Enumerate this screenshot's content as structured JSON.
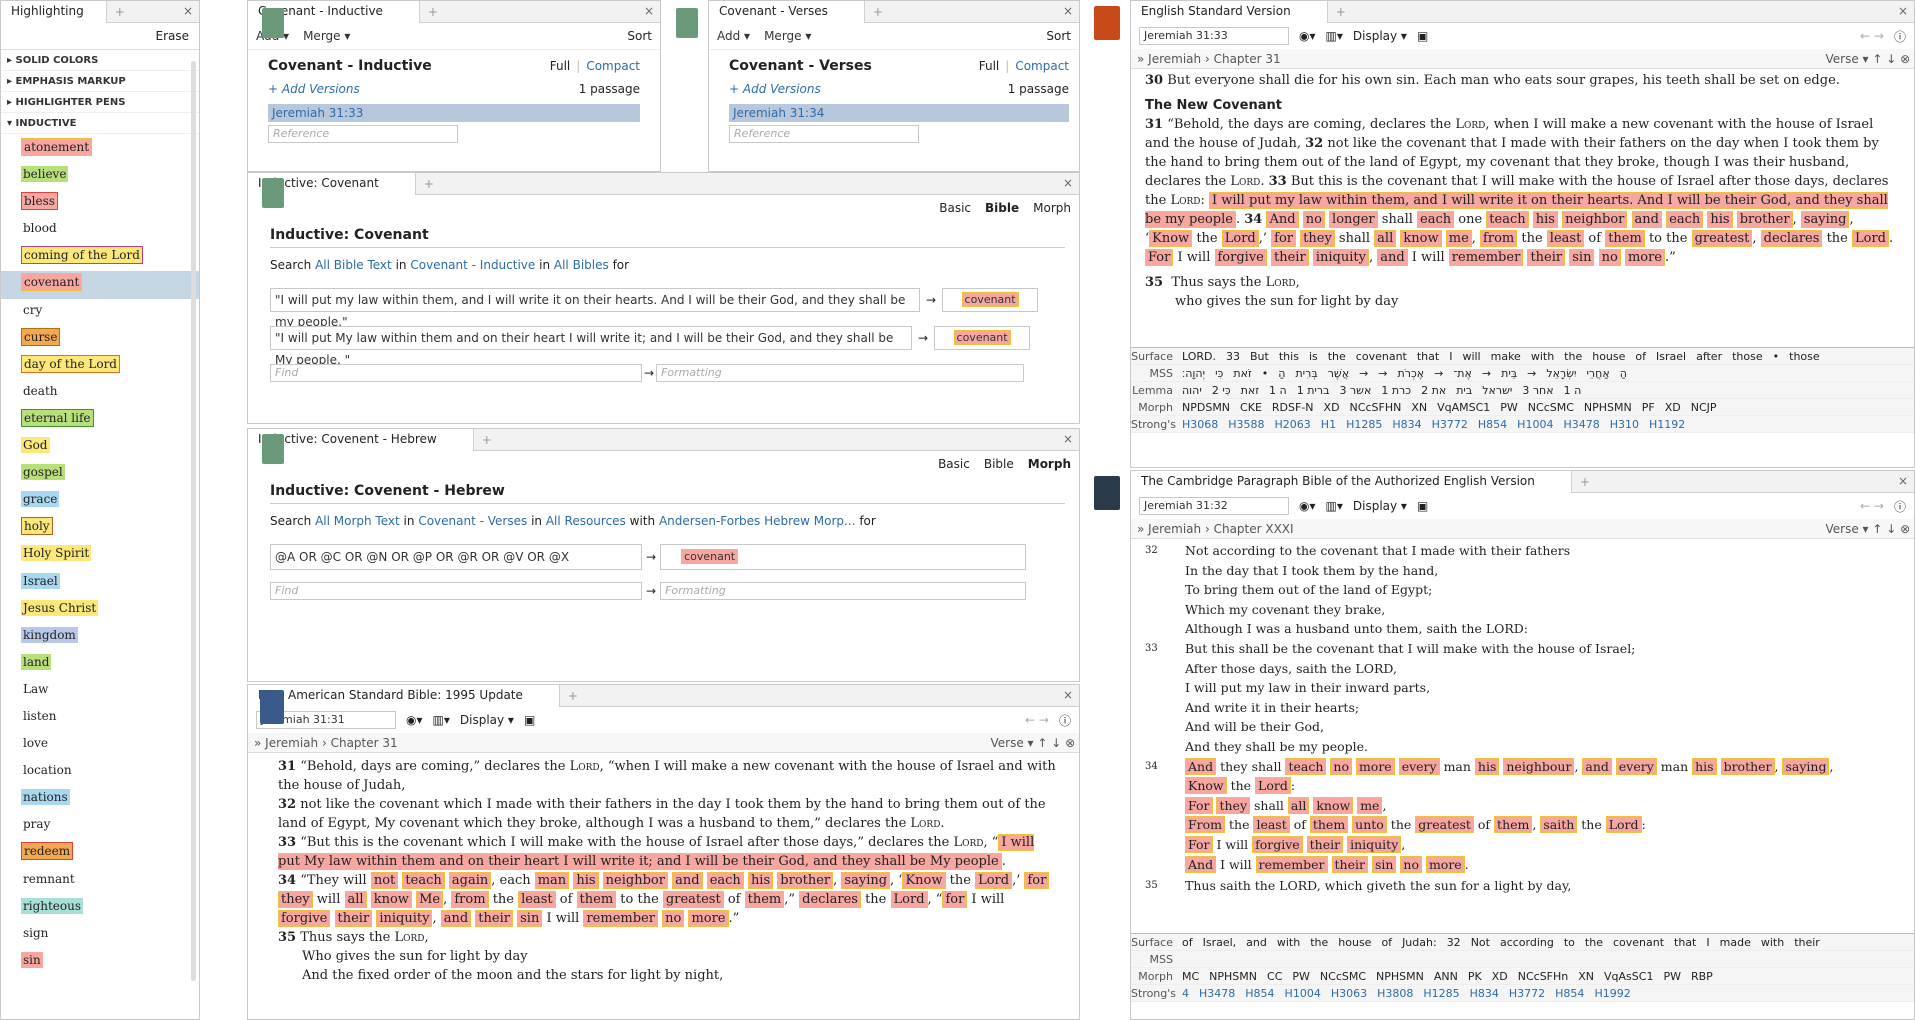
{
  "highlighting": {
    "tab": "Highlighting",
    "erase": "Erase",
    "groups": [
      "SOLID COLORS",
      "EMPHASIS MARKUP",
      "HIGHLIGHTER PENS",
      "INDUCTIVE"
    ],
    "styles": [
      {
        "label": "atonement",
        "bg": "#f7a6a0",
        "border": "#f0c040"
      },
      {
        "label": "believe",
        "bg": "#b8e07a",
        "border": ""
      },
      {
        "label": "bless",
        "bg": "#f7a6a0",
        "border": "#e04040"
      },
      {
        "label": "blood",
        "bg": "",
        "border": ""
      },
      {
        "label": "coming of the Lord",
        "bg": "#fbe77a",
        "border": "#c04080"
      },
      {
        "label": "covenant",
        "bg": "#f7a6a0",
        "border": "#f0c040"
      },
      {
        "label": "cry",
        "bg": "",
        "border": ""
      },
      {
        "label": "curse",
        "bg": "#f2a850",
        "border": "#b07010"
      },
      {
        "label": "day of the Lord",
        "bg": "#fbe77a",
        "border": "#e07020"
      },
      {
        "label": "death",
        "bg": "",
        "border": ""
      },
      {
        "label": "eternal life",
        "bg": "#b8e07a",
        "border": "#409040"
      },
      {
        "label": "God",
        "bg": "#fbe77a",
        "border": ""
      },
      {
        "label": "gospel",
        "bg": "#b8e07a",
        "border": ""
      },
      {
        "label": "grace",
        "bg": "#a8d8f0",
        "border": ""
      },
      {
        "label": "holy",
        "bg": "#fbe77a",
        "border": "#b06020"
      },
      {
        "label": "Holy Spirit",
        "bg": "#fbe77a",
        "border": ""
      },
      {
        "label": "Israel",
        "bg": "#a8d8f0",
        "border": ""
      },
      {
        "label": "Jesus Christ",
        "bg": "#fbe77a",
        "border": ""
      },
      {
        "label": "kingdom",
        "bg": "#b8c8e8",
        "border": ""
      },
      {
        "label": "land",
        "bg": "#b8e07a",
        "border": ""
      },
      {
        "label": "Law",
        "bg": "",
        "border": ""
      },
      {
        "label": "listen",
        "bg": "",
        "border": ""
      },
      {
        "label": "love",
        "bg": "",
        "border": ""
      },
      {
        "label": "location",
        "bg": "",
        "border": ""
      },
      {
        "label": "nations",
        "bg": "#a8d8f0",
        "border": ""
      },
      {
        "label": "pray",
        "bg": "",
        "border": ""
      },
      {
        "label": "redeem",
        "bg": "#f2a850",
        "border": "#e04040"
      },
      {
        "label": "remnant",
        "bg": "",
        "border": ""
      },
      {
        "label": "righteous",
        "bg": "#a8e0d8",
        "border": ""
      },
      {
        "label": "sign",
        "bg": "",
        "border": ""
      },
      {
        "label": "sin",
        "bg": "#f7a6a0",
        "border": ""
      }
    ]
  },
  "pp1": {
    "tab": "Covenant - Inductive",
    "add": "Add",
    "merge": "Merge",
    "sort": "Sort",
    "title": "Covenant - Inductive",
    "full": "Full",
    "compact": "Compact",
    "add_versions": "+ Add Versions",
    "count": "1 passage",
    "ref": "Jeremiah 31:33",
    "ph": "Reference"
  },
  "pp2": {
    "tab": "Covenant - Verses",
    "add": "Add",
    "merge": "Merge",
    "sort": "Sort",
    "title": "Covenant - Verses",
    "full": "Full",
    "compact": "Compact",
    "add_versions": "+ Add Versions",
    "count": "1 passage",
    "ref": "Jeremiah 31:34",
    "ph": "Reference"
  },
  "ind1": {
    "tab": "Inductive: Covenant",
    "basic": "Basic",
    "bible": "Bible",
    "morph": "Morph",
    "title": "Inductive: Covenant",
    "search": "Search",
    "in": "in",
    "for": "for",
    "t1": "All Bible Text",
    "t2": "Covenant - Inductive",
    "t3": "All Bibles",
    "q1": "\"I will put my law within them, and I will write it on their hearts. And I will be their God, and they shall be my people.\"",
    "q2": "\"I will put My law within them and on their heart I will write it; and I will be their God, and they shall be My people. \"",
    "hl": "covenant",
    "find": "Find",
    "fmt": "Formatting"
  },
  "ind2": {
    "tab": "Inductive: Covenent - Hebrew",
    "basic": "Basic",
    "bible": "Bible",
    "morph": "Morph",
    "title": "Inductive: Covenent - Hebrew",
    "search": "Search",
    "in": "in",
    "with": "with",
    "for": "for",
    "t1": "All Morph Text",
    "t2": "Covenant - Verses",
    "t3": "All Resources",
    "t4": "Andersen-Forbes Hebrew Morp...",
    "q1": "@A OR @C OR @N OR @P OR @R OR @V OR @X",
    "hl": "covenant",
    "find": "Find",
    "fmt": "Formatting"
  },
  "nasb": {
    "tab": "New American Standard Bible: 1995 Update",
    "ref": "Jeremiah 31:31",
    "display": "Display",
    "crumb1": "Jeremiah",
    "crumb2": "Chapter 31",
    "verse": "Verse"
  },
  "esv": {
    "tab": "English Standard Version",
    "ref": "Jeremiah 31:33",
    "display": "Display",
    "crumb1": "Jeremiah",
    "crumb2": "Chapter 31",
    "verse": "Verse",
    "heading": "The New Covenant",
    "v30": "But everyone shall die for his own sin. Each man who eats sour grapes, his teeth shall be set on edge.",
    "v35a": "Thus says the",
    "v35b": "who gives the sun for light by day",
    "il": {
      "surface_lbl": "Surface",
      "mss_lbl": "MSS",
      "lemma_lbl": "Lemma",
      "morph_lbl": "Morph",
      "strong_lbl": "Strong's",
      "surface": [
        "LORD.",
        "33",
        "But",
        "this",
        "is",
        "the",
        "covenant",
        "that",
        "I",
        "will",
        "make",
        "with",
        "the",
        "house",
        "of",
        "Israel",
        "after",
        "those",
        "•",
        "those"
      ],
      "mss": [
        "יְהוָה׃",
        "כִּי",
        "זֹאת",
        "•",
        "הַ",
        "בְּרִית",
        "אֲשֶׁר",
        "→",
        "→",
        "אֶכְרֹת",
        "→",
        "אֶת־",
        "→",
        "בֵּית",
        "→",
        "יִשְׂרָאֵל",
        "אַחֲרֵי",
        "הַ"
      ],
      "lemma": [
        "יהוה",
        "כִּי 2",
        "זאת",
        "ה 1",
        "ברית 1",
        "אשר 3",
        "כרת 1",
        "את 2",
        "בית",
        "ישראל",
        "אחר 3",
        "ה 1"
      ],
      "morph": [
        "NPDSMN",
        "CKE",
        "RDSF-N",
        "XD",
        "NCcSFHN",
        "XN",
        "VqAMSC1",
        "PW",
        "NCcSMC",
        "NPHSMN",
        "PF",
        "XD",
        "NCJP"
      ],
      "strong": [
        "H3068",
        "H3588",
        "H2063",
        "H1",
        "H1285",
        "H834",
        "H3772",
        "H854",
        "H1004",
        "H3478",
        "H310",
        "H1192"
      ]
    }
  },
  "cpb": {
    "tab": "The Cambridge Paragraph Bible of the Authorized English Version",
    "ref": "Jeremiah 31:32",
    "display": "Display",
    "crumb1": "Jeremiah",
    "crumb2": "Chapter XXXI",
    "verse": "Verse",
    "l1": "Not according to the covenant that I made with their fathers",
    "l2": "In the day that I took them by the hand,",
    "l3": "To bring them out of the land of Egypt;",
    "l4": "Which my covenant they brake,",
    "l5": "Although I was a husband unto them, saith the LORD:",
    "l6": "But this shall be the covenant that I will make with the house of Israel;",
    "l7": "After those days, saith the LORD,",
    "l8": "I will put my law in their inward parts,",
    "l9": "And write it in their hearts;",
    "l10": "And will be their God,",
    "l11": "And they shall be my people.",
    "l35": "Thus saith the LORD, which giveth the sun for a light by day,",
    "il": {
      "surface_lbl": "Surface",
      "mss_lbl": "MSS",
      "morph_lbl": "Morph",
      "strong_lbl": "Strong's",
      "surface": [
        "of",
        "Israel,",
        "and",
        "with",
        "the",
        "house",
        "of",
        "Judah:",
        "32",
        "Not",
        "according",
        "to",
        "the",
        "covenant",
        "that",
        "I",
        "made",
        "with",
        "their"
      ],
      "morph": [
        "MC",
        "NPHSMN",
        "CC",
        "PW",
        "NCcSMC",
        "NPHSMN",
        "ANN",
        "PK",
        "XD",
        "NCcSFHn",
        "XN",
        "VqAsSC1",
        "PW",
        "RBP"
      ],
      "strong": [
        "4",
        "H3478",
        "H854",
        "H1004",
        "H3063",
        "H3808",
        "H1285",
        "H834",
        "H3772",
        "H854",
        "H1992"
      ]
    }
  }
}
